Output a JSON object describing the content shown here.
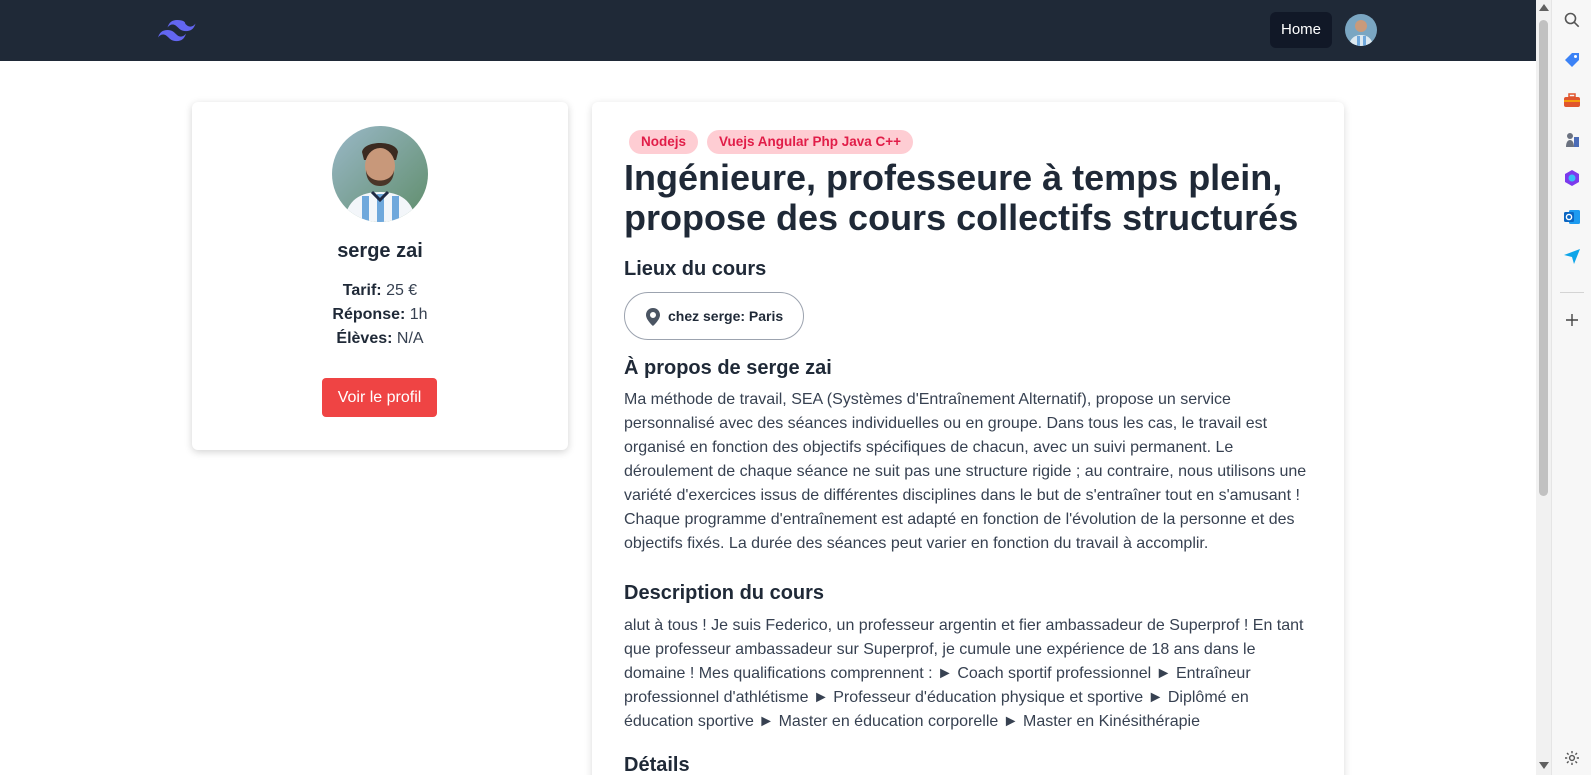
{
  "nav": {
    "logo_icon": "tailwind-logo-icon",
    "home_label": "Home",
    "avatar_icon": "user-avatar"
  },
  "profile": {
    "name": "serge zai",
    "tarif_label": "Tarif:",
    "tarif_value": "25 €",
    "reponse_label": "Réponse:",
    "reponse_value": "1h",
    "eleves_label": "Élèves:",
    "eleves_value": "N/A",
    "button_label": "Voir le profil"
  },
  "course": {
    "tags": [
      "Nodejs",
      "Vuejs Angular Php Java C++"
    ],
    "title": "Ingénieure, professeure à temps plein, propose des cours collectifs structurés",
    "locations_heading": "Lieux du cours",
    "location": "chez serge: Paris",
    "about_heading": "À propos de serge zai",
    "about_text": "Ma méthode de travail, SEA (Systèmes d'Entraînement Alternatif), propose un service personnalisé avec des séances individuelles ou en groupe. Dans tous les cas, le travail est organisé en fonction des objectifs spécifiques de chacun, avec un suivi permanent. Le déroulement de chaque séance ne suit pas une structure rigide ; au contraire, nous utilisons une variété d'exercices issus de différentes disciplines dans le but de s'entraîner tout en s'amusant ! Chaque programme d'entraînement est adapté en fonction de l'évolution de la personne et des objectifs fixés. La durée des séances peut varier en fonction du travail à accomplir.",
    "description_heading": "Description du cours",
    "description_text": "alut à tous ! Je suis Federico, un professeur argentin et fier ambassadeur de Superprof ! En tant que professeur ambassadeur sur Superprof, je cumule une expérience de 18 ans dans le domaine ! Mes qualifications comprennent : ► Coach sportif professionnel ► Entraîneur professionnel d'athlétisme ► Professeur d'éducation physique et sportive ► Diplômé en éducation sportive ► Master en éducation corporelle ► Master en Kinésithérapie",
    "details_heading": "Détails"
  },
  "colors": {
    "nav_bg": "#1f2937",
    "accent_red": "#ef4444",
    "tag_bg": "#fecdd3",
    "tag_text": "#e11d48"
  },
  "browser_sidebar": {
    "icons": [
      "search-icon",
      "tag-icon",
      "toolbox-icon",
      "chess-icon",
      "copilot-icon",
      "outlook-icon",
      "send-icon",
      "add-icon",
      "settings-icon"
    ]
  }
}
